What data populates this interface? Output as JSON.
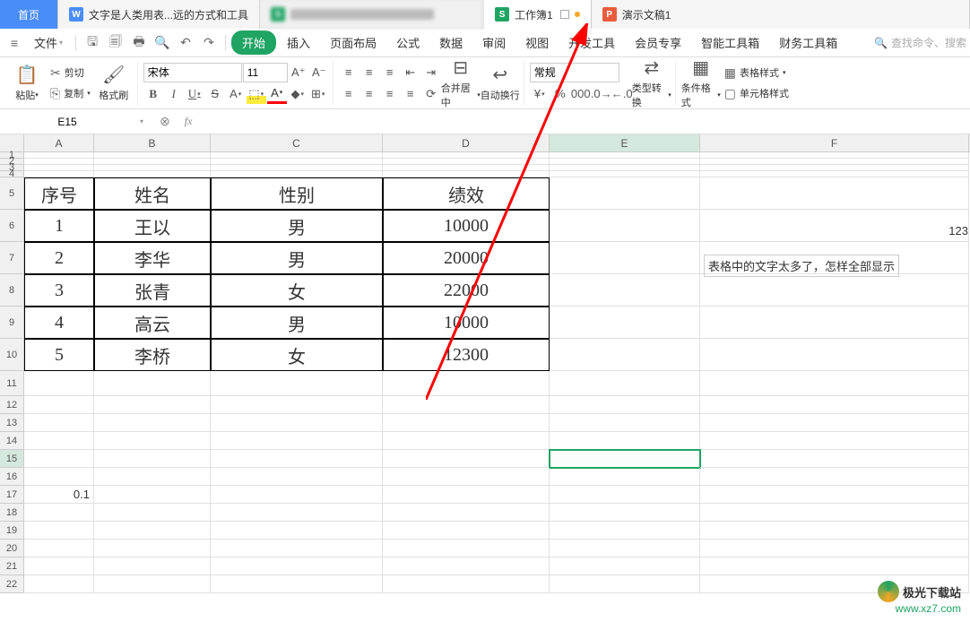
{
  "titleTabs": {
    "home": "首页",
    "word": "文字是人类用表...远的方式和工具",
    "sheet": "工作簿1",
    "pres": "演示文稿1"
  },
  "menu": {
    "file": "文件",
    "tabs": [
      "开始",
      "插入",
      "页面布局",
      "公式",
      "数据",
      "审阅",
      "视图",
      "开发工具",
      "会员专享",
      "智能工具箱",
      "财务工具箱"
    ],
    "search_placeholder": "查找命令、搜索"
  },
  "ribbon": {
    "paste": "粘贴",
    "cut": "剪切",
    "copy": "复制",
    "fmtpaint": "格式刷",
    "font_name": "宋体",
    "font_size": "11",
    "merge": "合并居中",
    "wrap": "自动换行",
    "numfmt": "常规",
    "typeconv": "类型转换",
    "condfmt": "条件格式",
    "tablestyle": "表格样式",
    "cellstyle": "单元格样式"
  },
  "namebox": "E15",
  "columns": [
    "A",
    "B",
    "C",
    "D",
    "E",
    "F"
  ],
  "table": {
    "headers": [
      "序号",
      "姓名",
      "性别",
      "绩效"
    ],
    "rows": [
      [
        "1",
        "王以",
        "男",
        "10000"
      ],
      [
        "2",
        "李华",
        "男",
        "20000"
      ],
      [
        "3",
        "张青",
        "女",
        "22000"
      ],
      [
        "4",
        "高云",
        "男",
        "10000"
      ],
      [
        "5",
        "李桥",
        "女",
        "12300"
      ]
    ]
  },
  "overflow": {
    "f6": "123",
    "f7": "表格中的文字太多了，怎样全部显示"
  },
  "a17": "0.1",
  "watermark": {
    "line1": "极光下载站",
    "line2": "www.xz7.com"
  },
  "chart_data": {
    "type": "table",
    "title": "",
    "columns": [
      "序号",
      "姓名",
      "性别",
      "绩效"
    ],
    "rows": [
      [
        1,
        "王以",
        "男",
        10000
      ],
      [
        2,
        "李华",
        "男",
        20000
      ],
      [
        3,
        "张青",
        "女",
        22000
      ],
      [
        4,
        "高云",
        "男",
        10000
      ],
      [
        5,
        "李桥",
        "女",
        12300
      ]
    ]
  }
}
